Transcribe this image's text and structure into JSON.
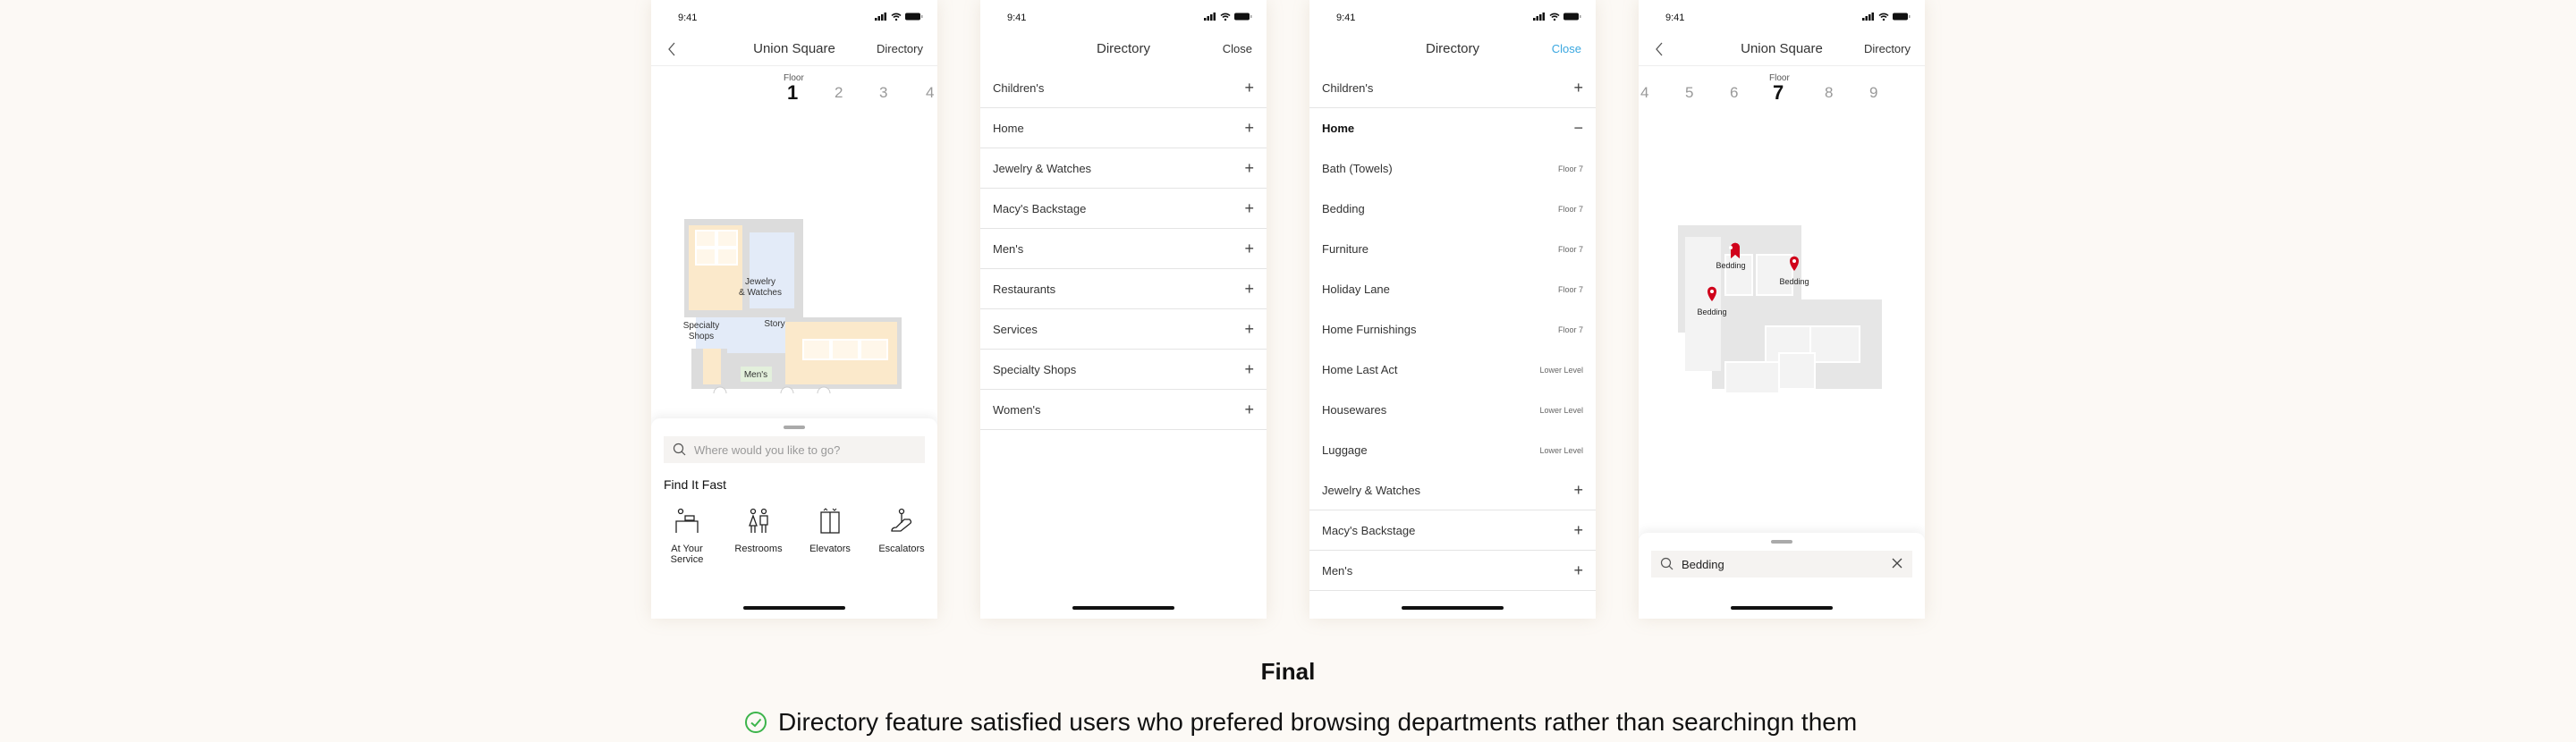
{
  "status_time": "9:41",
  "screen1": {
    "title": "Union Square",
    "right_action": "Directory",
    "floor_label": "Floor",
    "floors": [
      "1",
      "2",
      "3",
      "4"
    ],
    "active_floor": "1",
    "map_labels": [
      "Jewelry",
      "& Watches",
      "Specialty",
      "Shops",
      "Story",
      "Men's"
    ],
    "search_placeholder": "Where would you like to go?",
    "find_it_fast": "Find It Fast",
    "quick_links": [
      {
        "label1": "At Your",
        "label2": "Service",
        "icon": "service-desk-icon"
      },
      {
        "label1": "Restrooms",
        "label2": "",
        "icon": "restroom-icon"
      },
      {
        "label1": "Elevators",
        "label2": "",
        "icon": "elevator-icon"
      },
      {
        "label1": "Escalators",
        "label2": "",
        "icon": "escalator-icon"
      }
    ]
  },
  "screen2": {
    "title": "Directory",
    "right_action": "Close",
    "items": [
      "Children's",
      "Home",
      "Jewelry & Watches",
      "Macy's Backstage",
      "Men's",
      "Restaurants",
      "Services",
      "Specialty Shops",
      "Women's"
    ]
  },
  "screen3": {
    "title": "Directory",
    "right_action": "Close",
    "right_action_color": "#3aa7e0",
    "top_items": [
      "Children's"
    ],
    "open_item": "Home",
    "sub_items": [
      {
        "name": "Bath (Towels)",
        "floor": "Floor 7"
      },
      {
        "name": "Bedding",
        "floor": "Floor 7"
      },
      {
        "name": "Furniture",
        "floor": "Floor 7"
      },
      {
        "name": "Holiday Lane",
        "floor": "Floor 7"
      },
      {
        "name": "Home Furnishings",
        "floor": "Floor 7"
      },
      {
        "name": "Home Last Act",
        "floor": "Lower Level"
      },
      {
        "name": "Housewares",
        "floor": "Lower Level"
      },
      {
        "name": "Luggage",
        "floor": "Lower Level"
      }
    ],
    "bottom_items": [
      "Jewelry & Watches",
      "Macy's Backstage",
      "Men's"
    ]
  },
  "screen4": {
    "title": "Union Square",
    "right_action": "Directory",
    "floor_label": "Floor",
    "floors": [
      "4",
      "5",
      "6",
      "7",
      "8",
      "9"
    ],
    "active_floor": "7",
    "pins": [
      "Bedding",
      "Bedding",
      "Bedding"
    ],
    "pin_color": "#d0021b",
    "search_value": "Bedding"
  },
  "caption": {
    "heading": "Final",
    "note": "Directory feature satisfied users who prefered browsing departments rather than searchingn them",
    "check_color": "#3cb44b"
  }
}
